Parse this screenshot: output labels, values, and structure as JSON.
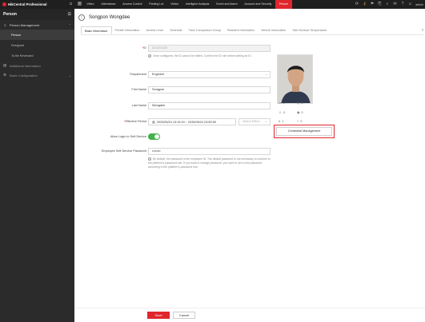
{
  "app": {
    "logo_text": "HikCentral Professional"
  },
  "topnav": {
    "items": [
      "Video",
      "Attendance",
      "Access Control",
      "Parking Lot",
      "Visitor",
      "Intelligent Analysis",
      "Event and Alarm",
      "Account and Security",
      "Person"
    ],
    "active": "Person",
    "user": "admin"
  },
  "sidebar": {
    "title": "Person",
    "groups": [
      {
        "label": "Person Management",
        "items": [
          "Person",
          "Resigned",
          "To Be Reviewed"
        ]
      },
      {
        "label": "Additional Information"
      },
      {
        "label": "Basic Configuration"
      }
    ],
    "active_item": "Person"
  },
  "page": {
    "title": "Songpon Wongdee"
  },
  "tabs": [
    "Basic Information",
    "Private Information",
    "Access Level",
    "Schedule",
    "Face Comparison Group",
    "Resident Information",
    "Vehicle Information",
    "Skin-Surface Temperature"
  ],
  "form": {
    "id": {
      "label": "ID",
      "value": "621001625",
      "note": "Once configured, the ID cannot be edited. Confirm the ID rule before setting an ID."
    },
    "department": {
      "label": "Department",
      "value": "Engineer"
    },
    "first_name": {
      "label": "First Name",
      "value": "Songpon"
    },
    "last_name": {
      "label": "Last Name",
      "value": "Wongdee"
    },
    "effective_period": {
      "label": "Effective Period",
      "start": "2023/05/24 13:19:19",
      "separator": "~",
      "end": "2033/05/24 23:59:59",
      "select_placeholder": "Select Effect..."
    },
    "self_service": {
      "label": "Allow Login to Self-Service",
      "enabled": true
    },
    "password": {
      "label": "Employee Self-Service Password",
      "value": "••••••••",
      "note": "By default, the password is the employee ID. The default password is not necessary to conform to the platform's password rule. If you want to change password, you have to set a new password according to the platform's password rule."
    }
  },
  "credentials": {
    "counts": {
      "card": "0",
      "fingerprint": "0",
      "face": "0",
      "iris": "0",
      "pin": "1",
      "other": "0"
    },
    "button_label": "Credential Management"
  },
  "actions": {
    "save": "Save",
    "cancel": "Cancel"
  },
  "colors": {
    "accent": "#e0262d",
    "toggle_on": "#3fb24a",
    "topbar": "#1f1f1f",
    "sidebar": "#2b2b2b"
  }
}
